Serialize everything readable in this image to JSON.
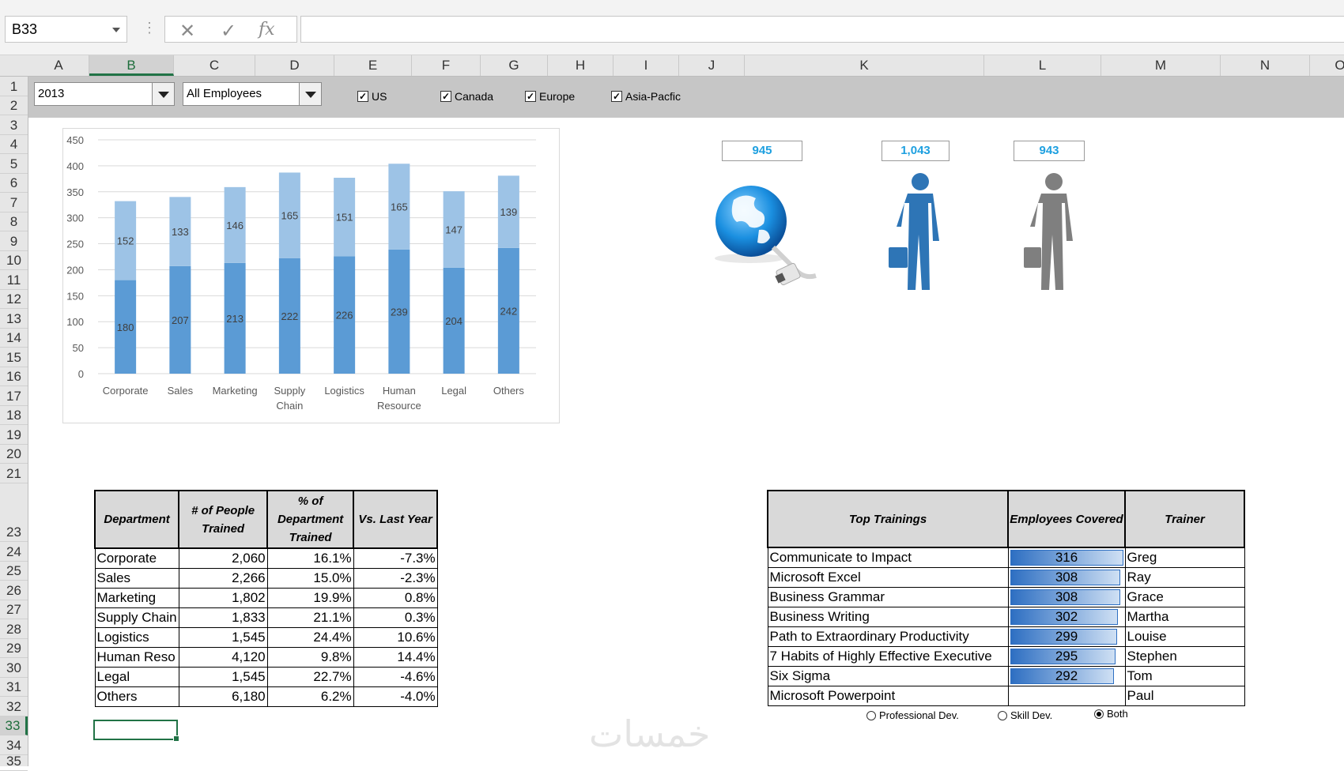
{
  "formula_bar": {
    "name_box": "B33",
    "cancel_icon": "✕",
    "enter_icon": "✓",
    "fx_label": "fx",
    "formula": ""
  },
  "columns": [
    "A",
    "B",
    "C",
    "D",
    "E",
    "F",
    "G",
    "H",
    "I",
    "J",
    "K",
    "L",
    "M",
    "N",
    "O"
  ],
  "selected_column": "B",
  "rows": [
    "1",
    "2",
    "3",
    "4",
    "5",
    "6",
    "7",
    "8",
    "9",
    "10",
    "11",
    "12",
    "13",
    "14",
    "15",
    "16",
    "17",
    "18",
    "19",
    "20",
    "21",
    "23",
    "24",
    "25",
    "26",
    "27",
    "28",
    "29",
    "30",
    "31",
    "32",
    "33",
    "34",
    "35"
  ],
  "selected_row": "33",
  "filters": {
    "year": "2013",
    "employee_type": "All Employees",
    "regions": [
      {
        "label": "US",
        "checked": true
      },
      {
        "label": "Canada",
        "checked": true
      },
      {
        "label": "Europe",
        "checked": true
      },
      {
        "label": "Asia-Pacfic",
        "checked": true
      }
    ]
  },
  "chart_data": {
    "type": "bar",
    "stacked": true,
    "categories": [
      "Corporate",
      "Sales",
      "Marketing",
      "Supply Chain",
      "Logistics",
      "Human Resource",
      "Legal",
      "Others"
    ],
    "series": [
      {
        "values": [
          180,
          207,
          213,
          222,
          226,
          239,
          204,
          242
        ],
        "color": "#5b9bd5"
      },
      {
        "values": [
          152,
          133,
          146,
          165,
          151,
          165,
          147,
          139
        ],
        "color": "#9dc3e6"
      }
    ],
    "ylim": [
      0,
      450
    ],
    "yticks": [
      "0",
      "50",
      "100",
      "150",
      "200",
      "250",
      "300",
      "350",
      "400",
      "450"
    ],
    "grid": true
  },
  "kpis": [
    {
      "value": "945",
      "icon": "globe-cable-icon"
    },
    {
      "value": "1,043",
      "icon": "businessman-blue-icon"
    },
    {
      "value": "943",
      "icon": "businessman-gray-icon"
    }
  ],
  "dept_table": {
    "headers": [
      "Department",
      "# of People Trained",
      "% of Department Trained",
      "Vs. Last Year"
    ],
    "rows": [
      [
        "Corporate",
        "2,060",
        "16.1%",
        "-7.3%"
      ],
      [
        "Sales",
        "2,266",
        "15.0%",
        "-2.3%"
      ],
      [
        "Marketing",
        "1,802",
        "19.9%",
        "0.8%"
      ],
      [
        "Supply Chain",
        "1,833",
        "21.1%",
        "0.3%"
      ],
      [
        "Logistics",
        "1,545",
        "24.4%",
        "10.6%"
      ],
      [
        "Human Reso",
        "4,120",
        "9.8%",
        "14.4%"
      ],
      [
        "Legal",
        "1,545",
        "22.7%",
        "-4.6%"
      ],
      [
        "Others",
        "6,180",
        "6.2%",
        "-4.0%"
      ]
    ]
  },
  "training_table": {
    "headers": [
      "Top Trainings",
      "Employees Covered",
      "Trainer"
    ],
    "rows": [
      {
        "training": "Communicate to Impact",
        "covered": "316",
        "trainer": "Greg",
        "fill": 1.0
      },
      {
        "training": "Microsoft Excel",
        "covered": "308",
        "trainer": "Ray",
        "fill": 0.975
      },
      {
        "training": "Business Grammar",
        "covered": "308",
        "trainer": "Grace",
        "fill": 0.975
      },
      {
        "training": "Business Writing",
        "covered": "302",
        "trainer": "Martha",
        "fill": 0.956
      },
      {
        "training": "Path to Extraordinary Productivity",
        "covered": "299",
        "trainer": "Louise",
        "fill": 0.946
      },
      {
        "training": "7 Habits of Highly Effective Executive",
        "covered": "295",
        "trainer": "Stephen",
        "fill": 0.934
      },
      {
        "training": "Six Sigma",
        "covered": "292",
        "trainer": "Tom",
        "fill": 0.924
      },
      {
        "training": "Microsoft Powerpoint",
        "covered": "",
        "trainer": "Paul",
        "fill": 0
      }
    ]
  },
  "training_type_options": [
    {
      "label": "Professional Dev.",
      "selected": false
    },
    {
      "label": "Skill Dev.",
      "selected": false
    },
    {
      "label": "Both",
      "selected": true
    }
  ],
  "watermark": "خمسات"
}
